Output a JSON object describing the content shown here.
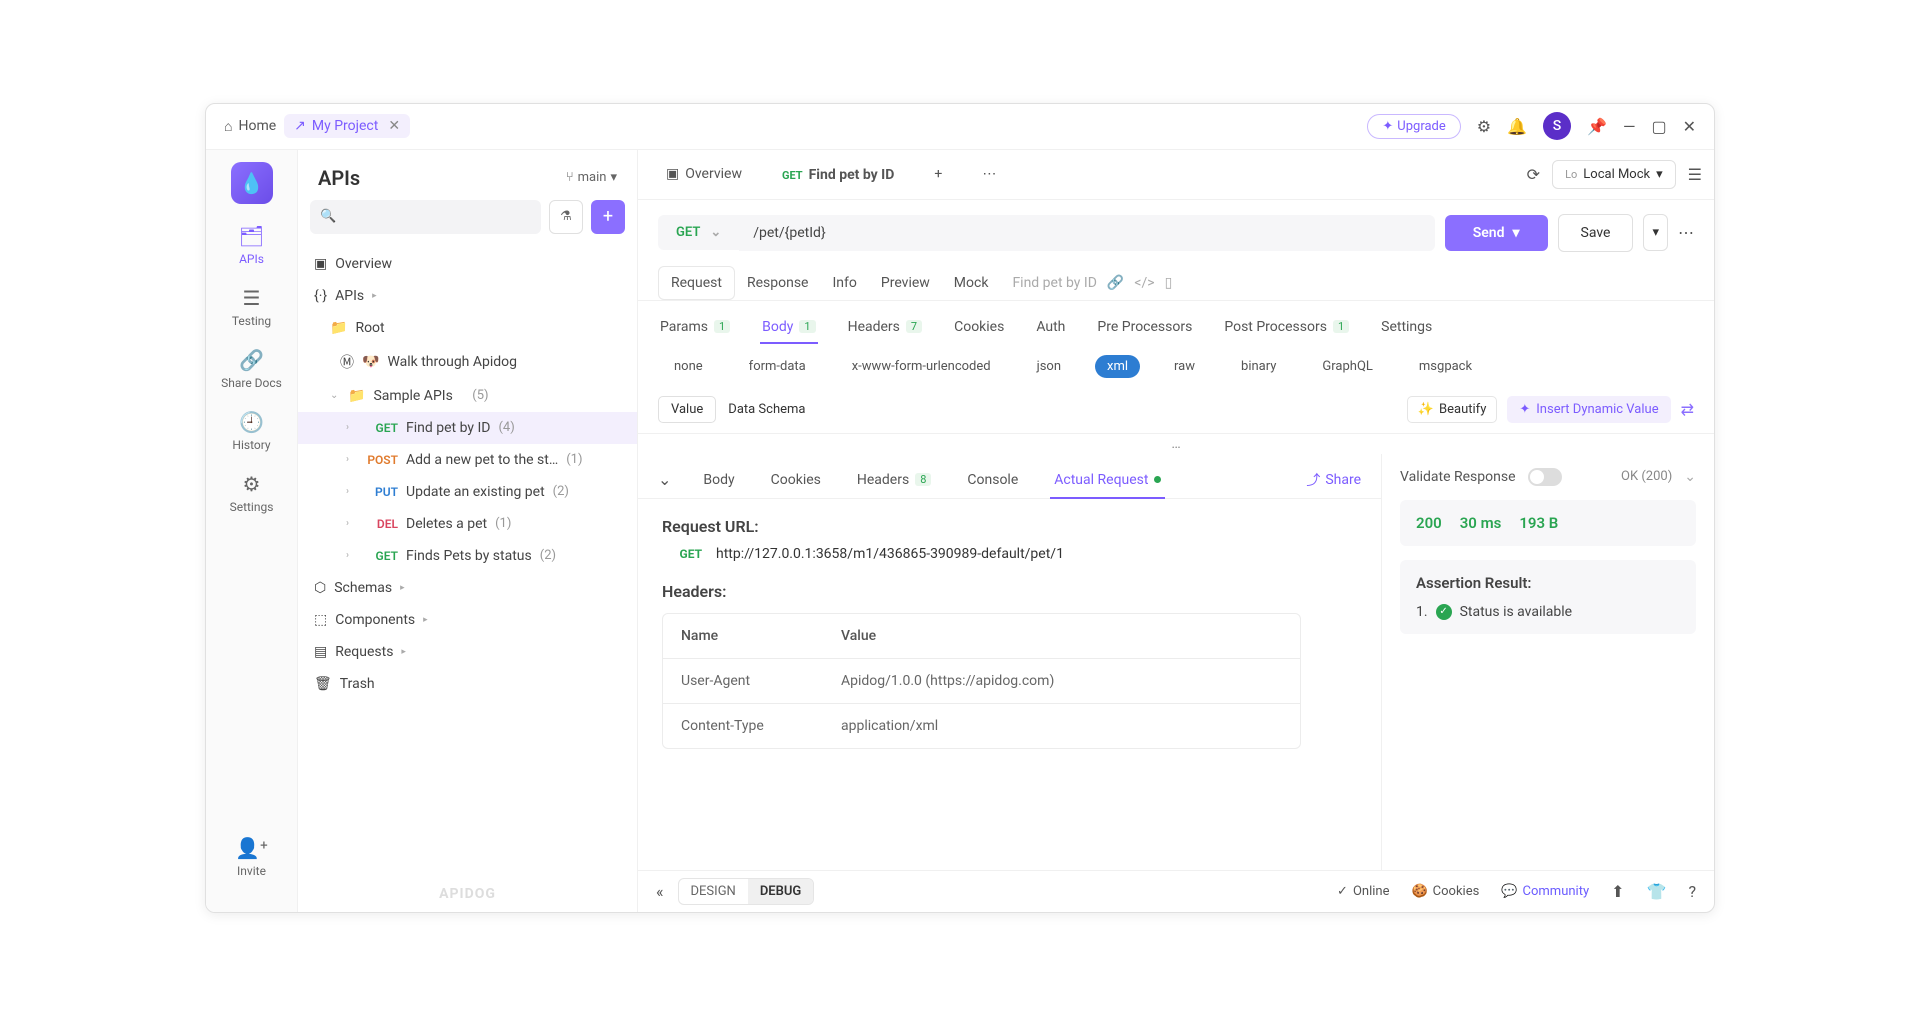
{
  "titlebar": {
    "home": "Home",
    "project": "My Project",
    "upgrade": "Upgrade",
    "avatar": "S"
  },
  "leftnav": {
    "apis": "APIs",
    "testing": "Testing",
    "shareDocs": "Share Docs",
    "history": "History",
    "settings": "Settings",
    "invite": "Invite"
  },
  "sidebar": {
    "title": "APIs",
    "branch": "main",
    "overview": "Overview",
    "apisSection": "APIs",
    "root": "Root",
    "walkthrough": "Walk through Apidog",
    "sampleApis": "Sample APIs",
    "sampleCount": "(5)",
    "endpoints": [
      {
        "method": "GET",
        "label": "Find pet by ID",
        "count": "(4)"
      },
      {
        "method": "POST",
        "label": "Add a new pet to the st…",
        "count": "(1)"
      },
      {
        "method": "PUT",
        "label": "Update an existing pet",
        "count": "(2)"
      },
      {
        "method": "DEL",
        "label": "Deletes a pet",
        "count": "(1)"
      },
      {
        "method": "GET",
        "label": "Finds Pets by status",
        "count": "(2)"
      }
    ],
    "schemas": "Schemas",
    "components": "Components",
    "requests": "Requests",
    "trash": "Trash",
    "brand": "APIDOG"
  },
  "tabs": {
    "overview": "Overview",
    "current": "Find pet by ID",
    "currentMethod": "GET",
    "mockLo": "Lo",
    "mock": "Local Mock"
  },
  "url": {
    "method": "GET",
    "path": "/pet/{petId}",
    "send": "Send",
    "save": "Save"
  },
  "subtabs": {
    "request": "Request",
    "response": "Response",
    "info": "Info",
    "preview": "Preview",
    "mock": "Mock",
    "crumb": "Find pet by ID"
  },
  "reqTabs": {
    "params": "Params",
    "paramsBadge": "1",
    "body": "Body",
    "bodyBadge": "1",
    "headers": "Headers",
    "headersBadge": "7",
    "cookies": "Cookies",
    "auth": "Auth",
    "pre": "Pre Processors",
    "post": "Post Processors",
    "postBadge": "1",
    "settings": "Settings"
  },
  "bodyTypes": {
    "none": "none",
    "formdata": "form-data",
    "urlenc": "x-www-form-urlencoded",
    "json": "json",
    "xml": "xml",
    "raw": "raw",
    "binary": "binary",
    "graphql": "GraphQL",
    "msgpack": "msgpack"
  },
  "valueRow": {
    "value": "Value",
    "schema": "Data Schema",
    "beautify": "Beautify",
    "insert": "Insert Dynamic Value"
  },
  "respTabs": {
    "body": "Body",
    "cookies": "Cookies",
    "headers": "Headers",
    "headersBadge": "8",
    "console": "Console",
    "actual": "Actual Request",
    "share": "Share"
  },
  "reqDetail": {
    "urlLabel": "Request URL:",
    "method": "GET",
    "url": "http://127.0.0.1:3658/m1/436865-390989-default/pet/1",
    "headersLabel": "Headers:",
    "th1": "Name",
    "th2": "Value",
    "rows": [
      {
        "name": "User-Agent",
        "value": "Apidog/1.0.0 (https://apidog.com)"
      },
      {
        "name": "Content-Type",
        "value": "application/xml"
      }
    ]
  },
  "respSide": {
    "validate": "Validate Response",
    "ok": "OK (200)",
    "status": "200",
    "time": "30 ms",
    "size": "193 B",
    "assertTitle": "Assertion Result:",
    "assertNum": "1.",
    "assertText": "Status is available"
  },
  "footer": {
    "design": "DESIGN",
    "debug": "DEBUG",
    "online": "Online",
    "cookies": "Cookies",
    "community": "Community"
  }
}
